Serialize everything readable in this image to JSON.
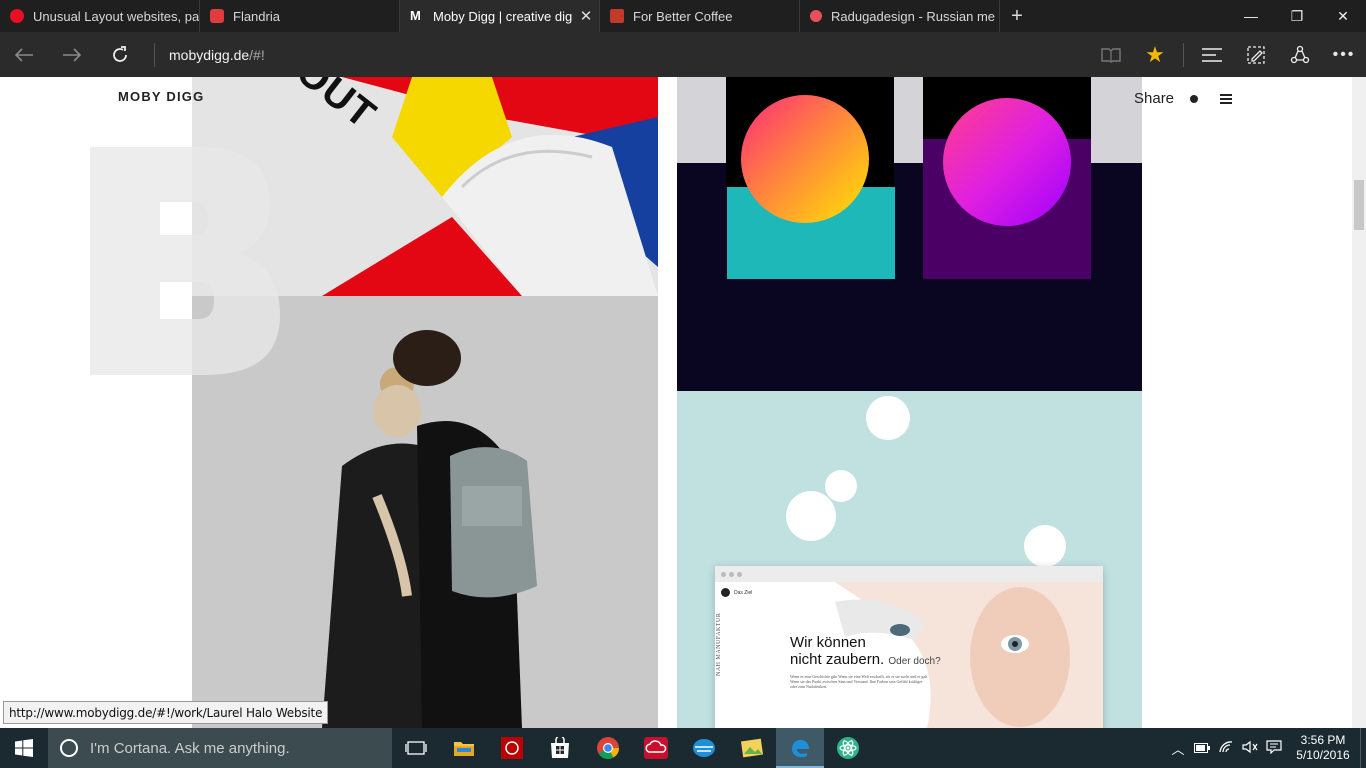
{
  "tabs": [
    {
      "title": "Unusual Layout websites, pa",
      "favicon_color": "#e81123",
      "active": false,
      "close": ""
    },
    {
      "title": "Flandria",
      "favicon_color": "#e03c3c",
      "active": false,
      "close": ""
    },
    {
      "title": "Moby Digg | creative dig",
      "favicon_color": "#ffffff",
      "favicon_letter": "M",
      "active": true,
      "close": "✕"
    },
    {
      "title": "For Better Coffee",
      "favicon_color": "#c0392b",
      "active": false,
      "close": ""
    },
    {
      "title": "Radugadesign - Russian me",
      "favicon_color": "#e8505b",
      "active": false,
      "close": ""
    }
  ],
  "new_tab_label": "+",
  "window_controls": {
    "minimize": "—",
    "restore": "❐",
    "close": "✕"
  },
  "address": {
    "host": "mobydigg.de",
    "path": "/#!"
  },
  "page": {
    "logo": "MOBY DIGG",
    "share_label": "Share",
    "big_letter": "B",
    "poster_text": "OUT",
    "mockup_headline_1": "Wir können",
    "mockup_headline_2": "nicht zaubern.",
    "mockup_headline_small": "Oder doch?",
    "mockup_nav": "Das Ziel",
    "mockup_side_text": "NAH MANUFAKTUR",
    "mockup_body": "Wenn es eine Geschichte gibt Wenn sie eine Welt erschafft, als er sie sucht und er gab Wenn sie das Punkt zwischen Sinn und Verstand. Ihre Farben sein Gefühl kräftiger oder zum Nachdenken."
  },
  "status_url": "http://www.mobydigg.de/#!/work/Laurel Halo Website",
  "taskbar": {
    "cortana_placeholder": "I'm Cortana. Ask me anything.",
    "apps": [
      "task-view-icon",
      "file-explorer-icon",
      "app-red-icon",
      "store-icon",
      "chrome-icon",
      "creative-cloud-icon",
      "app-blue-icon",
      "photos-icon",
      "edge-icon",
      "atom-icon"
    ],
    "time": "3:56 PM",
    "date": "5/10/2016"
  }
}
